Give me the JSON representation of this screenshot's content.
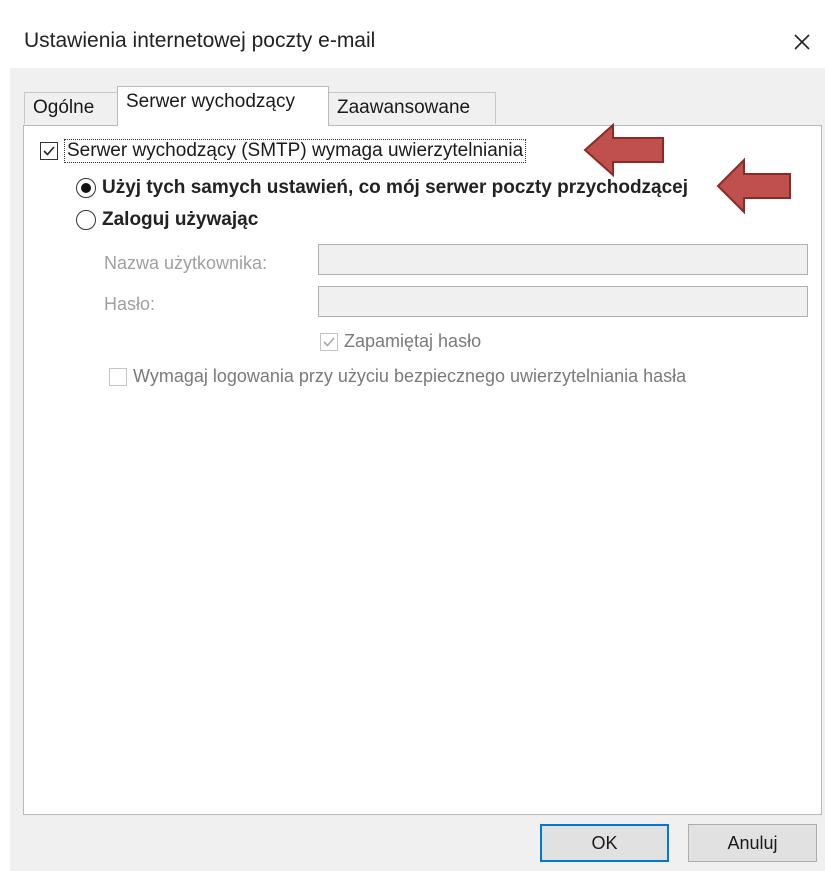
{
  "window": {
    "title": "Ustawienia internetowej poczty e-mail",
    "close_symbol": "✕"
  },
  "tabs": [
    {
      "label": "Ogólne",
      "active": false
    },
    {
      "label": "Serwer wychodzący",
      "active": true
    },
    {
      "label": "Zaawansowane",
      "active": false
    }
  ],
  "smtp": {
    "auth_checkbox": {
      "label_before": "S",
      "label_underlined": "",
      "label": "Serwer wychodzący (SMTP) wymaga uwierzytelniania",
      "checked": true
    },
    "radio_same": {
      "label": "Użyj tych samych ustawień, co mój serwer poczty przychodzącej",
      "selected": true
    },
    "radio_login": {
      "label": "Zaloguj używając",
      "selected": false
    },
    "username": {
      "label": "Nazwa użytkownika:",
      "value": ""
    },
    "password": {
      "label": "Hasło:",
      "value": ""
    },
    "remember": {
      "label": "Zapamiętaj hasło",
      "checked": true
    },
    "spa": {
      "label": "Wymagaj logowania przy użyciu bezpiecznego uwierzytelniania hasła",
      "checked": false
    }
  },
  "buttons": {
    "ok": "OK",
    "cancel": "Anuluj"
  },
  "annotation": {
    "arrow_color": "#c0504d",
    "arrow_outline": "#8c2a27"
  }
}
